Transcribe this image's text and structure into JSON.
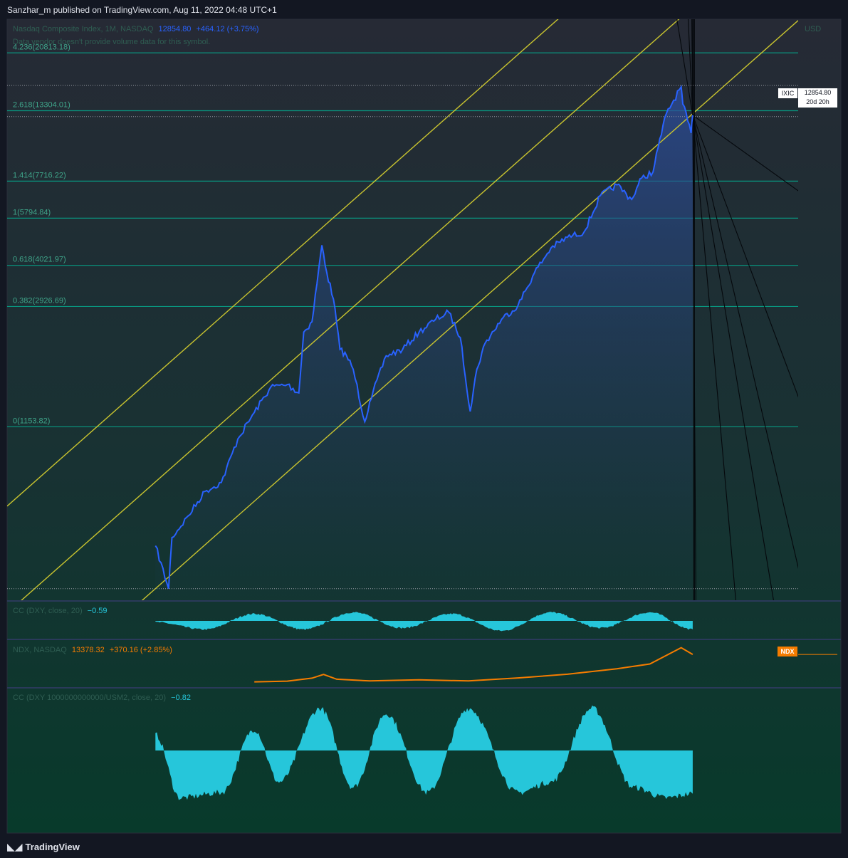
{
  "publish_line": "Sanzhar_m published on TradingView.com, Aug 11, 2022 04:48 UTC+1",
  "brand": "TradingView",
  "main_legend": {
    "symbol": "Nasdaq Composite Index, 1M, NASDAQ",
    "price": "12854.80",
    "change": "+464.12 (+3.75%)",
    "note": "Data vendor doesn't provide volume data for this symbol."
  },
  "price_label": {
    "ticker": "IXIC",
    "price": "12854.80",
    "countdown": "20d 20h"
  },
  "axis_unit": "USD",
  "indicator1": {
    "title": "CC (DXY, close, 20)",
    "value": "−0.59"
  },
  "indicator2": {
    "title": "NDX, NASDAQ",
    "value": "13378.32",
    "change": "+370.16 (+2.85%)",
    "badge": "NDX"
  },
  "indicator3": {
    "title": "CC (DXY 1000000000000/USM2, close, 20)",
    "value": "−0.82"
  },
  "colors": {
    "price_line": "#2962ff",
    "fib_line": "#089981",
    "channel": "#c9c42f",
    "ndx_line": "#f57c00",
    "corr_fill": "#26c6da",
    "value_text": "#26c6da"
  },
  "chart_data": [
    {
      "type": "line",
      "name": "Nasdaq Composite Index, 1M",
      "scale": "log",
      "x": [
        1990,
        1990.8,
        1991,
        1992,
        1993,
        1994,
        1995,
        1996,
        1997,
        1998,
        1998.7,
        1999,
        1999.5,
        2000.1,
        2000.4,
        2000.8,
        2001.2,
        2001.6,
        2002,
        2002.7,
        2003,
        2004,
        2005,
        2006,
        2007,
        2007.8,
        2008.5,
        2009.1,
        2009.5,
        2010,
        2011,
        2012,
        2013,
        2014,
        2015,
        2016,
        2017,
        2018,
        2018.9,
        2019.5,
        2020.2,
        2020.5,
        2021,
        2021.9,
        2022,
        2022.5,
        2022.6
      ],
      "y": [
        460,
        330,
        490,
        580,
        700,
        750,
        1050,
        1290,
        1570,
        1600,
        1500,
        2400,
        2600,
        4700,
        3800,
        3100,
        2100,
        2000,
        1800,
        1200,
        1400,
        2000,
        2100,
        2400,
        2650,
        2800,
        2300,
        1300,
        1800,
        2200,
        2650,
        2950,
        3800,
        4600,
        5000,
        5200,
        6900,
        7500,
        6700,
        7900,
        8300,
        10000,
        13000,
        16000,
        14000,
        11200,
        12854.8
      ],
      "fib_levels": [
        {
          "ratio": "0",
          "value": 1153.82,
          "label": "0(1153.82)"
        },
        {
          "ratio": "0.382",
          "value": 2926.69,
          "label": "0.382(2926.69)"
        },
        {
          "ratio": "0.618",
          "value": 4021.97,
          "label": "0.618(4021.97)"
        },
        {
          "ratio": "1",
          "value": 5794.84,
          "label": "1(5794.84)"
        },
        {
          "ratio": "1.414",
          "value": 7716.22,
          "label": "1.414(7716.22)"
        },
        {
          "ratio": "2.618",
          "value": 13304.01,
          "label": "2.618(13304.01)"
        },
        {
          "ratio": "4.236",
          "value": 20813.18,
          "label": "4.236(20813.18)"
        }
      ],
      "xlim": [
        1981,
        2029
      ],
      "ylim": [
        300,
        27000
      ]
    },
    {
      "type": "area",
      "name": "CC (DXY, close, 20)",
      "x": [
        1990,
        1993,
        1996,
        1999,
        2002,
        2005,
        2008,
        2011,
        2014,
        2017,
        2020,
        2022.6
      ],
      "y": [
        -0.1,
        -0.6,
        0.5,
        -0.6,
        0.6,
        -0.5,
        0.5,
        -0.7,
        0.6,
        -0.5,
        0.6,
        -0.59
      ],
      "ylim": [
        -1,
        1
      ]
    },
    {
      "type": "line",
      "name": "NDX, NASDAQ",
      "x": [
        1996,
        1998,
        1999.5,
        2000.2,
        2001,
        2003,
        2006,
        2009,
        2012,
        2015,
        2018,
        2020,
        2021.9,
        2022.6
      ],
      "y": [
        800,
        1100,
        2500,
        4200,
        2000,
        1200,
        1700,
        1200,
        2600,
        4300,
        6800,
        9000,
        16500,
        13378.32
      ],
      "ylim": [
        0,
        18000
      ]
    },
    {
      "type": "area",
      "name": "CC (DXY 1000000000000/USM2, close, 20)",
      "x": [
        1990,
        1991.5,
        1994,
        1996,
        1997.5,
        2000,
        2002,
        2004,
        2006.5,
        2009,
        2012,
        2014,
        2016.5,
        2019,
        2021,
        2022.6
      ],
      "y": [
        0.3,
        -0.9,
        -0.8,
        0.4,
        -0.6,
        0.8,
        -0.7,
        0.7,
        -0.8,
        0.8,
        -0.8,
        -0.6,
        0.8,
        -0.7,
        -0.9,
        -0.82
      ],
      "ylim": [
        -1,
        1
      ]
    }
  ]
}
